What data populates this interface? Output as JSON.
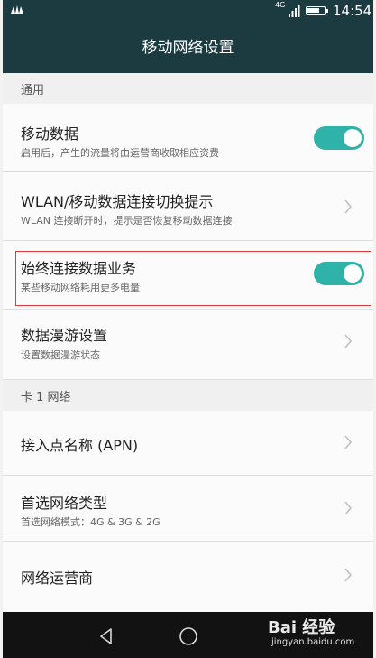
{
  "status": {
    "network": "4G",
    "time": "14:54",
    "battery_level": 0.8
  },
  "title": "移动网络设置",
  "sections": {
    "general": "通用",
    "sim1": "卡 1 网络"
  },
  "items": [
    {
      "title": "移动数据",
      "subtitle": "启用后，产生的流量将由运营商收取相应资费",
      "toggle_on": true
    },
    {
      "title": "WLAN/移动数据连接切换提示",
      "subtitle": "WLAN 连接断开时，提示是否恢复移动数据连接"
    },
    {
      "title": "始终连接数据业务",
      "subtitle": "某些移动网络耗用更多电量",
      "toggle_on": true
    },
    {
      "title": "数据漫游设置",
      "subtitle": "设置数据漫游状态"
    },
    {
      "title": "接入点名称 (APN)"
    },
    {
      "title": "首选网络类型",
      "subtitle": "首选网络模式：4G & 3G & 2G"
    },
    {
      "title": "网络运营商"
    }
  ],
  "icons": {
    "brand": "huawei-logo-icon",
    "signal": "signal-bars-icon",
    "battery": "battery-icon",
    "chevron": "chevron-right-icon",
    "back": "back-triangle-icon",
    "home": "home-circle-icon"
  },
  "watermark": {
    "brand": "Bai 经验",
    "url": "jingyan.baidu.com"
  },
  "colors": {
    "titlebar": "#1b3b40",
    "toggle": "#2fb3a8",
    "highlight": "#e03a3a",
    "navbar": "#121212"
  }
}
